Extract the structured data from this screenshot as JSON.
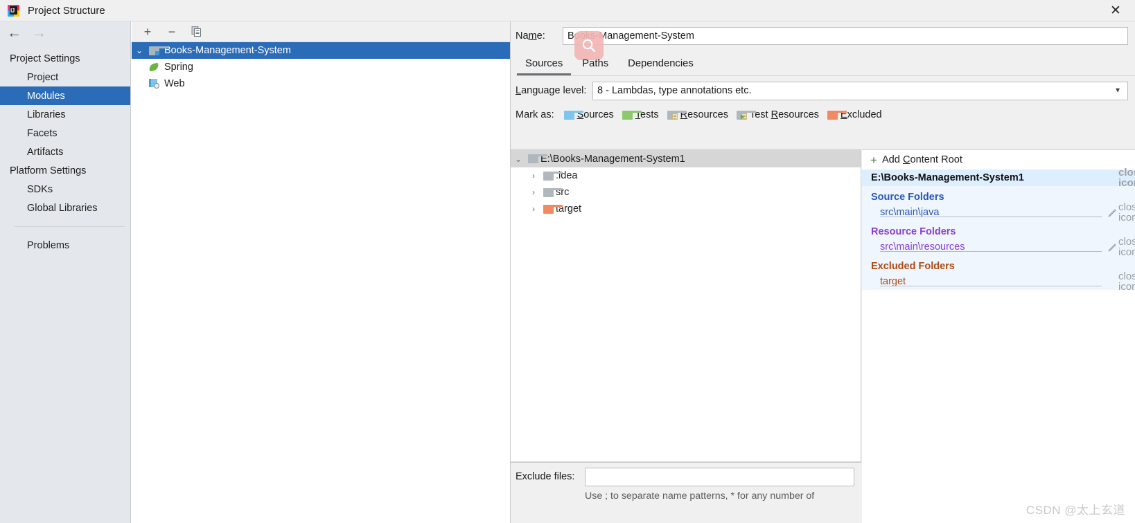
{
  "window": {
    "title": "Project Structure",
    "app_icon": "intellij-idea-logo",
    "close_label": "✕"
  },
  "sidebar": {
    "nav": {
      "back_icon": "←",
      "forward_icon": "→"
    },
    "groups": [
      {
        "label": "Project Settings",
        "items": [
          {
            "label": "Project",
            "selected": false
          },
          {
            "label": "Modules",
            "selected": true
          },
          {
            "label": "Libraries",
            "selected": false
          },
          {
            "label": "Facets",
            "selected": false
          },
          {
            "label": "Artifacts",
            "selected": false
          }
        ]
      },
      {
        "label": "Platform Settings",
        "items": [
          {
            "label": "SDKs",
            "selected": false
          },
          {
            "label": "Global Libraries",
            "selected": false
          }
        ]
      }
    ],
    "problems_label": "Problems"
  },
  "modules_panel": {
    "toolbar": {
      "add_label": "+",
      "remove_label": "−",
      "copy_label": "copy-icon"
    },
    "tree": [
      {
        "label": "Books-Management-System",
        "icon": "module-folder-icon",
        "expanded": true,
        "selected": true,
        "depth": 0
      },
      {
        "label": "Spring",
        "icon": "spring-icon",
        "selected": false,
        "depth": 1
      },
      {
        "label": "Web",
        "icon": "web-icon",
        "selected": false,
        "depth": 1
      }
    ]
  },
  "details": {
    "name_label": "Name:",
    "name_label_pre": "Na",
    "name_label_accel": "m",
    "name_label_post": "e:",
    "name_value": "Books-Management-System",
    "cursor_overlay_icon": "search-magnifier-icon",
    "tabs": [
      {
        "label": "Sources",
        "active": true
      },
      {
        "label": "Paths",
        "active": false
      },
      {
        "label": "Dependencies",
        "active": false
      }
    ],
    "language_level": {
      "label_pre": "",
      "label_accel": "L",
      "label_post": "anguage level:",
      "value": "8 - Lambdas, type annotations etc.",
      "arrow_icon": "chevron-down-icon"
    },
    "mark_as": {
      "label": "Mark as:",
      "options": [
        {
          "label_pre": "",
          "accel": "S",
          "label_post": "ources",
          "color": "#7fc4ec",
          "icon": "sources-folder-icon"
        },
        {
          "label_pre": "",
          "accel": "T",
          "label_post": "ests",
          "color": "#8bc96c",
          "icon": "tests-folder-icon"
        },
        {
          "label_pre": "",
          "accel": "R",
          "label_post": "esources",
          "color": "#b0b8be",
          "icon": "resources-folder-icon"
        },
        {
          "label_pre": "Test ",
          "accel": "R",
          "label_post": "esources",
          "color": "#b0b8be",
          "icon": "test-resources-folder-icon"
        },
        {
          "label_pre": "",
          "accel": "E",
          "label_post": "xcluded",
          "color": "#ef8a62",
          "icon": "excluded-folder-icon"
        }
      ]
    },
    "source_tree": {
      "root": {
        "label": "E:\\Books-Management-System1",
        "icon": "folder-gray-icon",
        "expanded": true
      },
      "children": [
        {
          "label": ".idea",
          "icon": "folder-gray-icon",
          "color": "#b0b8be",
          "expanded": false
        },
        {
          "label": "src",
          "icon": "folder-gray-icon",
          "color": "#b0b8be",
          "expanded": false
        },
        {
          "label": "target",
          "icon": "folder-orange-icon",
          "color": "#ef8a62",
          "expanded": false
        }
      ]
    },
    "exclude_files": {
      "label": "Exclude files:",
      "value": "",
      "placeholder": "",
      "hint": "Use ; to separate name patterns, * for any number of"
    }
  },
  "content_roots": {
    "add_pre": "Add ",
    "add_accel": "C",
    "add_post": "ontent Root",
    "plus_icon": "plus-icon",
    "root_path": "E:\\Books-Management-System1",
    "remove_icon": "close-icon",
    "edit_icon": "pencil-icon",
    "groups": [
      {
        "title": "Source Folders",
        "color": "#2a56b8",
        "kind": "src",
        "paths": [
          "src\\main\\java"
        ],
        "has_edit": true
      },
      {
        "title": "Resource Folders",
        "color": "#8a3fd1",
        "kind": "res",
        "paths": [
          "src\\main\\resources"
        ],
        "has_edit": true
      },
      {
        "title": "Excluded Folders",
        "color": "#b04a12",
        "kind": "exc",
        "paths": [
          "target"
        ],
        "has_edit": false
      }
    ]
  },
  "watermark": {
    "text": "CSDN @太上玄道"
  }
}
